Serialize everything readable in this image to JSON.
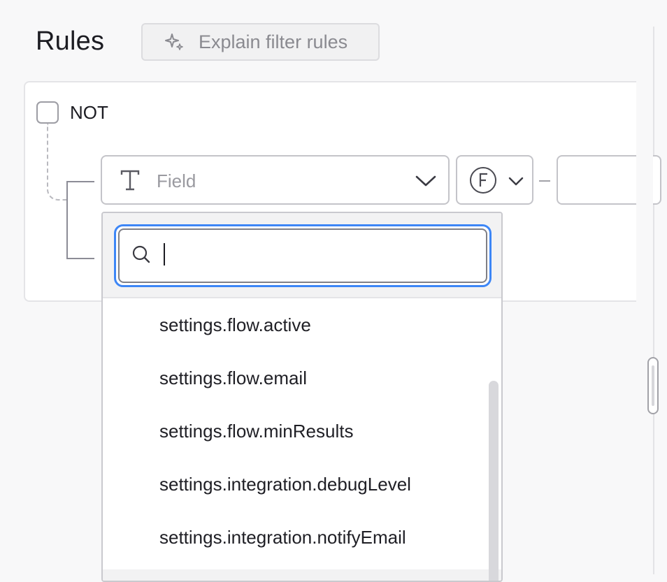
{
  "header": {
    "title": "Rules",
    "explain_button_label": "Explain filter rules",
    "explain_button_icon": "sparkle-icon"
  },
  "rule_group": {
    "negate_label": "NOT",
    "negate_checked": false,
    "condition": {
      "field_placeholder": "Field",
      "field_type_icon": "text-type-icon",
      "function_icon": "function-icon",
      "value": ""
    }
  },
  "field_dropdown": {
    "search_value": "",
    "options": [
      "settings.flow.active",
      "settings.flow.email",
      "settings.flow.minResults",
      "settings.integration.debugLevel",
      "settings.integration.notifyEmail"
    ]
  },
  "colors": {
    "focus_ring": "#3d86f6",
    "border": "#c4c4c9",
    "background": "#f8f8f9"
  }
}
